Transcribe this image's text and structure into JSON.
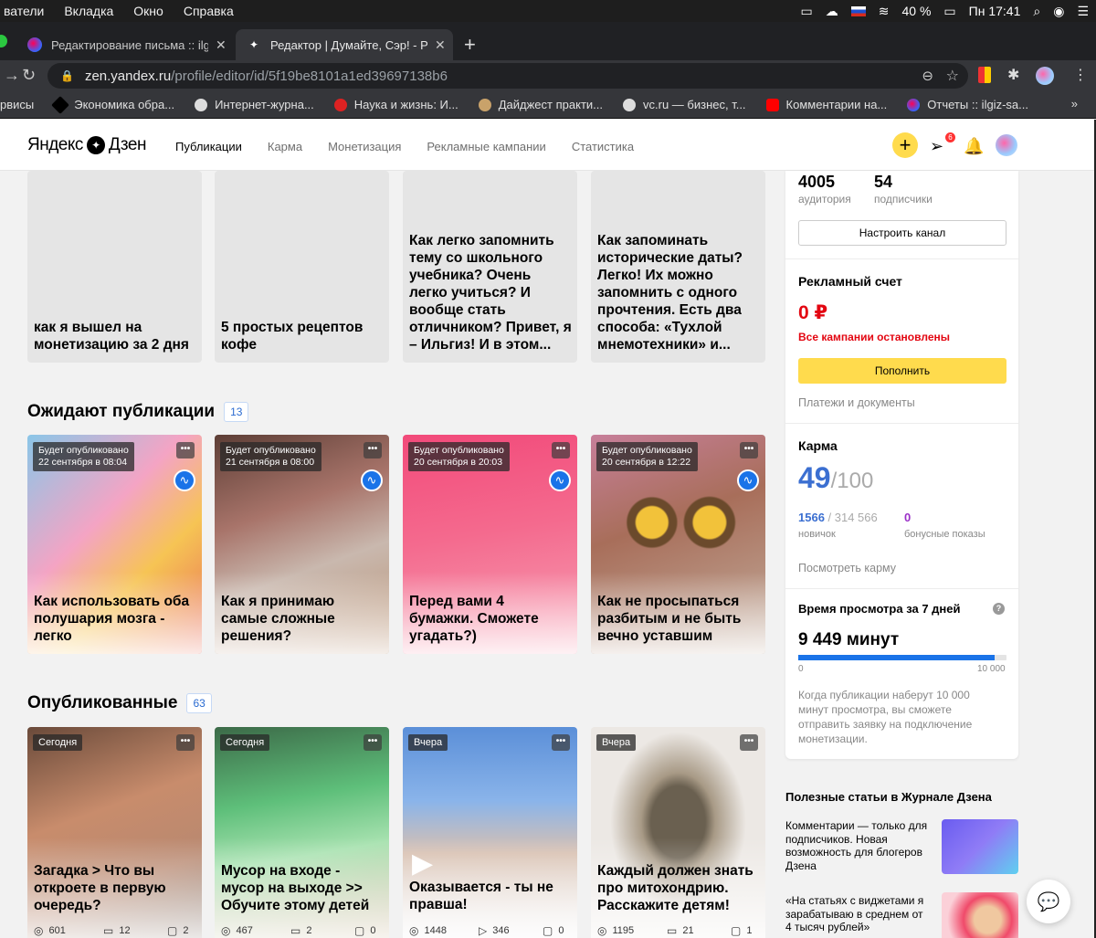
{
  "menubar": {
    "items": [
      "ватели",
      "Вкладка",
      "Окно",
      "Справка"
    ],
    "battery": "40 %",
    "clock": "Пн 17:41"
  },
  "tabs": [
    {
      "title": "Редактирование письма :: ilg",
      "active": false
    },
    {
      "title": "Редактор | Думайте, Сэр! - Р",
      "active": true
    }
  ],
  "address": {
    "domain": "zen.yandex.ru",
    "path": "/profile/editor/id/5f19be8101a1ed39697138b6"
  },
  "bookmarks": [
    "рвисы",
    "Экономика обра...",
    "Интернет-журна...",
    "Наука и жизнь: И...",
    "Дайджест практи...",
    "vc.ru — бизнес, т...",
    "Комментарии на...",
    "Отчеты :: ilgiz-sa..."
  ],
  "header": {
    "logo_left": "Яндекс",
    "logo_right": "Дзен",
    "nav": [
      "Публикации",
      "Карма",
      "Монетизация",
      "Рекламные кампании",
      "Статистика"
    ],
    "notifications_badge": "6"
  },
  "drafts": [
    {
      "title": "как я вышел на монетизацию за 2 дня"
    },
    {
      "title": "5 простых рецептов кофе"
    },
    {
      "title": "Как легко запомнить тему со школьного учебника? Очень легко учиться? И вообще стать отличником? Привет, я – Ильгиз! И в этом..."
    },
    {
      "title": "Как запоминать исторические даты? Легко! Их можно запомнить с одного прочтения. Есть два способа: «Тухлой мнемотехники» и..."
    }
  ],
  "pending": {
    "title": "Ожидают публикации",
    "count": "13",
    "cards": [
      {
        "badge_line1": "Будет опубликовано",
        "badge_line2": "22 сентября в 08:04",
        "title": "Как использовать оба полушария мозга - легко"
      },
      {
        "badge_line1": "Будет опубликовано",
        "badge_line2": "21 сентября в 08:00",
        "title": "Как я принимаю самые сложные решения?"
      },
      {
        "badge_line1": "Будет опубликовано",
        "badge_line2": "20 сентября в 20:03",
        "title": "Перед вами 4 бумажки. Сможете угадать?)"
      },
      {
        "badge_line1": "Будет опубликовано",
        "badge_line2": "20 сентября в 12:22",
        "title": "Как не просыпаться разбитым и не быть вечно уставшим"
      }
    ]
  },
  "published": {
    "title": "Опубликованные",
    "count": "63",
    "cards": [
      {
        "badge": "Сегодня",
        "title": "Загадка > Что вы откроете в первую очередь?",
        "views": "601",
        "reads": "12",
        "comments": "2"
      },
      {
        "badge": "Сегодня",
        "title": "Мусор на входе - мусор на выходе >> Обучите этому детей",
        "views": "467",
        "reads": "2",
        "comments": "0"
      },
      {
        "badge": "Вчера",
        "title": "Оказывается - ты не правша!",
        "views": "1448",
        "reads": "346",
        "comments": "0"
      },
      {
        "badge": "Вчера",
        "title": "Каждый должен знать про митохондрию. Расскажите детям!",
        "views": "1195",
        "reads": "21",
        "comments": "1"
      }
    ]
  },
  "panel": {
    "audience_value": "4005",
    "audience_label": "аудитория",
    "subscribers_value": "54",
    "subscribers_label": "подписчики",
    "setup_button": "Настроить канал",
    "ad_title": "Рекламный счет",
    "ad_balance": "0 ₽",
    "ad_status": "Все кампании остановлены",
    "topup_button": "Пополнить",
    "payments_link": "Платежи и документы",
    "karma_title": "Карма",
    "karma_value": "49",
    "karma_max": "/100",
    "beginner_value": "1566",
    "beginner_total": " / 314 566",
    "beginner_label": "новичок",
    "bonus_value": "0",
    "bonus_label": "бонусные показы",
    "karma_link": "Посмотреть карму",
    "watch_title": "Время просмотра за 7 дней",
    "watch_minutes": "9 449 минут",
    "watch_progress": 0.9449,
    "bar_min": "0",
    "bar_max": "10 000",
    "watch_desc": "Когда публикации наберут 10 000 минут просмотра, вы сможете отправить заявку на подключение монетизации."
  },
  "journal": {
    "title": "Полезные статьи в Журнале Дзена",
    "items": [
      "Комментарии — только для подписчиков. Новая возможность для блогеров Дзена",
      "«На статьях с виджетами я зарабатываю в среднем от 4 тысяч рублей»"
    ]
  },
  "colors": {
    "accent_yellow": "#ffdb4d",
    "karma_blue": "#3b6fd1",
    "error_red": "#e30611",
    "bonus_purple": "#9b30c8"
  }
}
